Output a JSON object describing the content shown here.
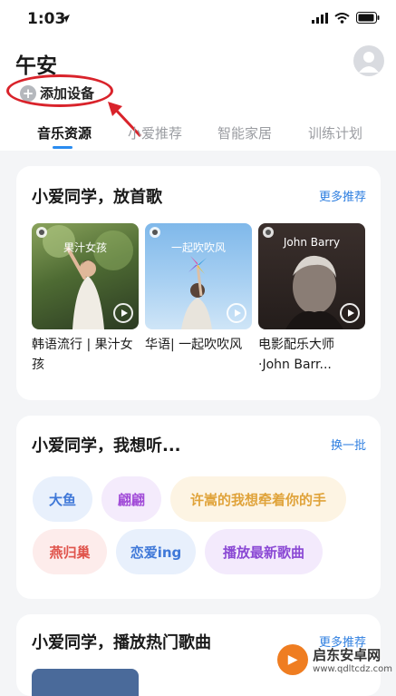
{
  "status_bar": {
    "time": "1:03"
  },
  "header": {
    "greeting": "午安",
    "add_device": "添加设备",
    "tabs": [
      {
        "label": "音乐资源",
        "active": true
      },
      {
        "label": "小爱推荐",
        "active": false
      },
      {
        "label": "智能家居",
        "active": false
      },
      {
        "label": "训练计划",
        "active": false
      }
    ]
  },
  "music_card": {
    "title": "小爱同学，放首歌",
    "more_link": "更多推荐",
    "items": [
      {
        "thumb_text": "果汁女孩",
        "caption": "韩语流行 | 果汁女孩"
      },
      {
        "thumb_text": "一起吹吹风",
        "caption": "华语| 一起吹吹风"
      },
      {
        "thumb_text": "John Barry",
        "caption": "电影配乐大师 ·John Barr..."
      }
    ]
  },
  "listen_card": {
    "title": "小爱同学，我想听...",
    "refresh_link": "换一批",
    "chips": [
      {
        "label": "大鱼",
        "color": "#3f78d8",
        "bg": "#e8f0fc"
      },
      {
        "label": "翩翩",
        "color": "#a24dd8",
        "bg": "#f4ebfc"
      },
      {
        "label": "许嵩的我想牵着你的手",
        "color": "#e0a33a",
        "bg": "#fdf4e3"
      },
      {
        "label": "燕归巢",
        "color": "#e0544c",
        "bg": "#fdeceb"
      },
      {
        "label": "恋爱ing",
        "color": "#3f78d8",
        "bg": "#e8f0fc"
      },
      {
        "label": "播放最新歌曲",
        "color": "#8a48d4",
        "bg": "#f3eafc"
      }
    ]
  },
  "hot_card": {
    "title": "小爱同学，播放热门歌曲",
    "more_link": "更多推荐"
  },
  "watermark": {
    "line1": "启东安卓网",
    "line2": "www.qdltcdz.com"
  }
}
